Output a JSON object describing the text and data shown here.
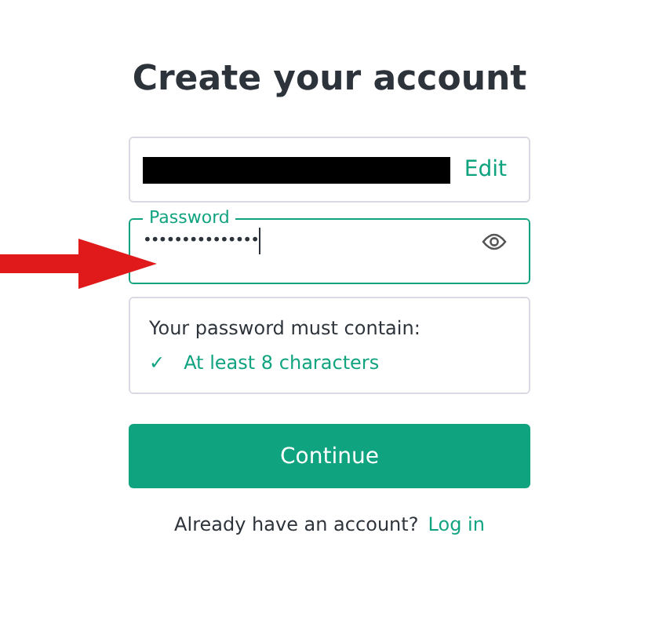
{
  "title": "Create your account",
  "email_field": {
    "redacted": true,
    "action": "Edit"
  },
  "password_field": {
    "label": "Password",
    "value": "•••••••••••••••",
    "focused": true
  },
  "requirements": {
    "heading": "Your password must contain:",
    "items": [
      {
        "mark": "✓",
        "text": "At least 8 characters",
        "met": true
      }
    ]
  },
  "continue_button": "Continue",
  "footer": {
    "text": "Already have an account?",
    "link": "Log in"
  },
  "annotation": {
    "kind": "arrow"
  }
}
